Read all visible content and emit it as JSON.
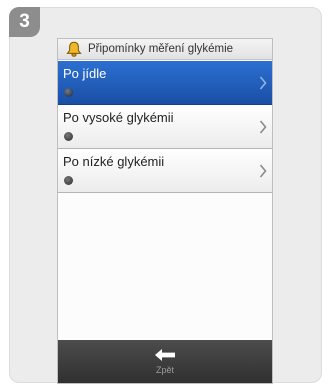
{
  "step": {
    "number": "3"
  },
  "screen": {
    "header": {
      "title": "Připomínky měření glykémie",
      "icon": "bell-icon"
    },
    "menu": {
      "items": [
        {
          "label": "Po jídle",
          "selected": true,
          "icon": "chevron-right-icon"
        },
        {
          "label": "Po vysoké glykémii",
          "selected": false,
          "icon": "chevron-right-icon"
        },
        {
          "label": "Po nízké glykémii",
          "selected": false,
          "icon": "chevron-right-icon"
        }
      ]
    },
    "footer": {
      "back_label": "Zpět",
      "icon": "back-arrow-icon"
    }
  },
  "colors": {
    "selected": "#1f5cbc",
    "header_icon": "#e0a21b",
    "bottom_bar": "#3a3a3a"
  }
}
